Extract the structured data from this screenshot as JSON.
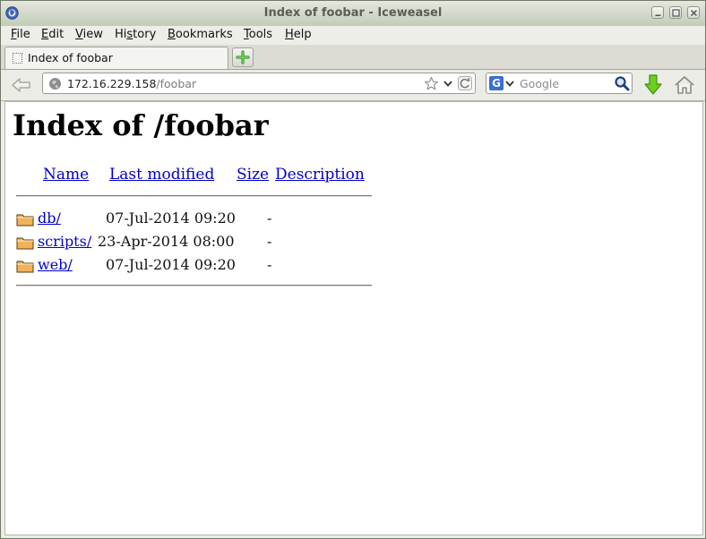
{
  "window": {
    "title": "Index of foobar - Iceweasel"
  },
  "menubar": {
    "items": [
      {
        "accel": "F",
        "rest": "ile"
      },
      {
        "accel": "E",
        "rest": "dit"
      },
      {
        "accel": "V",
        "rest": "iew"
      },
      {
        "pre": "Hi",
        "accel": "s",
        "rest": "tory"
      },
      {
        "accel": "B",
        "rest": "ookmarks"
      },
      {
        "accel": "T",
        "rest": "ools"
      },
      {
        "accel": "H",
        "rest": "elp"
      }
    ]
  },
  "tabs": [
    {
      "title": "Index of foobar",
      "selected": true
    }
  ],
  "navbar": {
    "url_host": "172.16.229.158",
    "url_path": "/foobar",
    "search_placeholder": "Google",
    "search_engine_icon": "G",
    "icons": [
      "back-icon",
      "globe-icon",
      "star-icon",
      "dropdown-icon",
      "reload-icon",
      "search-icon",
      "download-icon",
      "home-icon"
    ]
  },
  "page": {
    "heading": "Index of /foobar",
    "columns": {
      "name": "Name",
      "modified": "Last modified",
      "size": "Size",
      "description": "Description"
    },
    "entries": [
      {
        "name": "db/",
        "modified": "07-Jul-2014 09:20",
        "size": "-"
      },
      {
        "name": "scripts/",
        "modified": "23-Apr-2014 08:00",
        "size": "-"
      },
      {
        "name": "web/",
        "modified": "07-Jul-2014 09:20",
        "size": "-"
      }
    ]
  },
  "colors": {
    "link": "#0000cc",
    "titlebar": "#c2cbb8",
    "folder": "#f2b25a"
  }
}
